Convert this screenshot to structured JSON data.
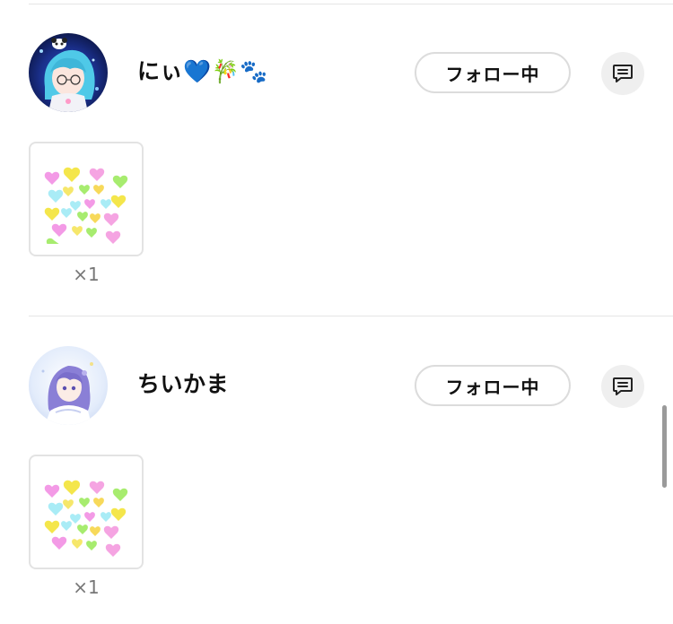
{
  "entries": [
    {
      "username": "にぃ💙🎋🐾",
      "follow_label": "フォロー中",
      "message_icon": "message-icon",
      "avatar": "avatar",
      "gift": {
        "icon": "hearts-gift-icon",
        "count": "×1"
      }
    },
    {
      "username": "ちいかま",
      "follow_label": "フォロー中",
      "message_icon": "message-icon",
      "avatar": "avatar",
      "gift": {
        "icon": "hearts-gift-icon",
        "count": "×1"
      }
    }
  ],
  "colors": {
    "divider": "#e6e6e6",
    "button_border": "#dcdcdc",
    "message_button_bg": "#efefef",
    "count_text": "#777777"
  }
}
